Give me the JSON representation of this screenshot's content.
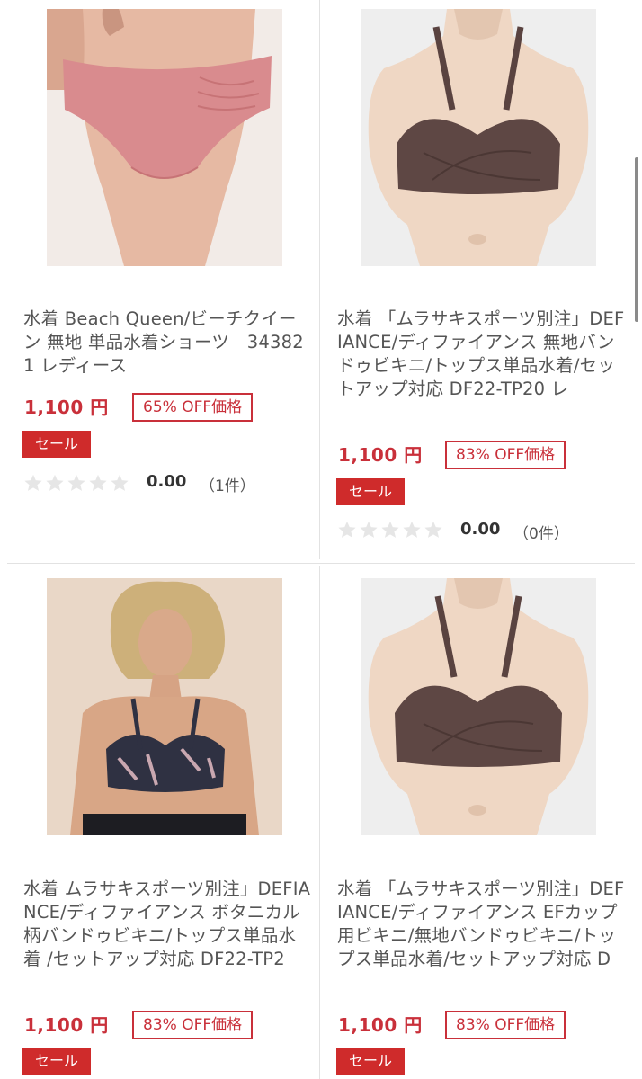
{
  "products": [
    {
      "title": "水着 Beach Queen/ビーチクイーン 無地 単品水着ショーツ　343821 レディース",
      "price": "1,100 円",
      "discount": "65% OFF価格",
      "sale_label": "セール",
      "rating": "0.00",
      "review_count": "（1件）",
      "image": "pink-bikini-bottom"
    },
    {
      "title": "水着 「ムラサキスポーツ別注」DEFIANCE/ディファイアンス 無地バンドゥビキニ/トップス単品水着/セットアップ対応 DF22-TP20 レ",
      "price": "1,100 円",
      "discount": "83% OFF価格",
      "sale_label": "セール",
      "rating": "0.00",
      "review_count": "（0件）",
      "image": "brown-bandeau-top"
    },
    {
      "title": "水着 ムラサキスポーツ別注」DEFIANCE/ディファイアンス ボタニカル柄バンドゥビキニ/トップス単品水着 /セットアップ対応 DF22-TP2",
      "price": "1,100 円",
      "discount": "83% OFF価格",
      "sale_label": "セール",
      "image": "botanical-bandeau-model"
    },
    {
      "title": "水着 「ムラサキスポーツ別注」DEFIANCE/ディファイアンス EFカップ用ビキニ/無地バンドゥビキニ/トップス単品水着/セットアップ対応 D",
      "price": "1,100 円",
      "discount": "83% OFF価格",
      "sale_label": "セール",
      "image": "brown-bandeau-top-ef"
    }
  ],
  "colors": {
    "price_red": "#c9303a",
    "sale_bg": "#cf2b2b",
    "divider": "#e2e2e2",
    "star_empty": "#e6e6e6"
  }
}
